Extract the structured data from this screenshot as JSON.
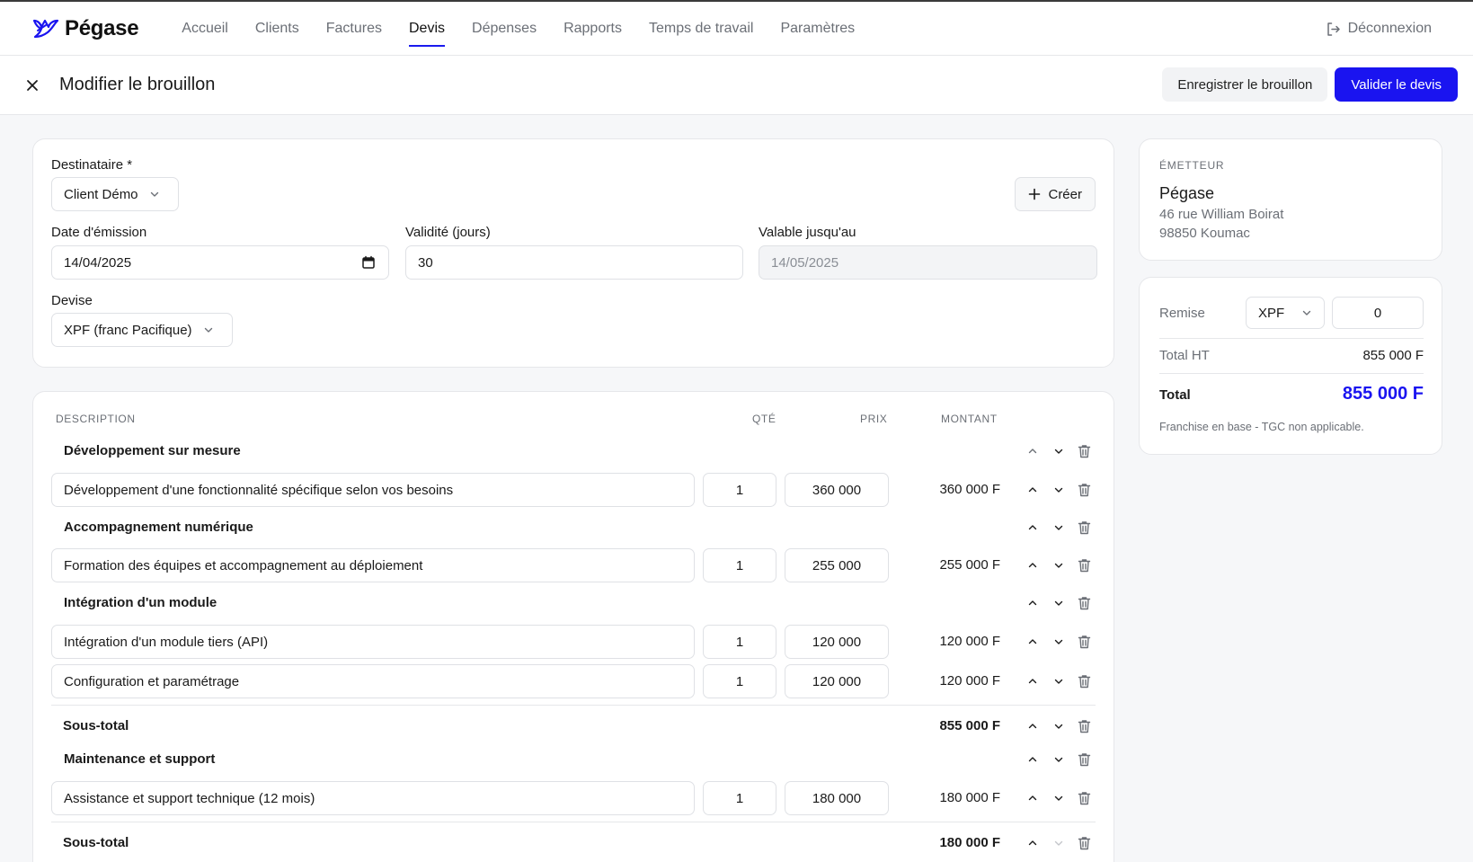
{
  "brand": {
    "name": "Pégase",
    "accent": "#1a14f0"
  },
  "nav": {
    "items": [
      "Accueil",
      "Clients",
      "Factures",
      "Devis",
      "Dépenses",
      "Rapports",
      "Temps de travail",
      "Paramètres"
    ],
    "active": "Devis",
    "logout": "Déconnexion"
  },
  "page": {
    "title": "Modifier le brouillon",
    "save_label": "Enregistrer le brouillon",
    "validate_label": "Valider le devis"
  },
  "form": {
    "recipient_label": "Destinataire *",
    "recipient_value": "Client Démo",
    "create_label": "Créer",
    "issue_date_label": "Date d'émission",
    "issue_date_value": "14/04/2025",
    "validity_label": "Validité (jours)",
    "validity_value": "30",
    "valid_until_label": "Valable jusqu'au",
    "valid_until_value": "14/05/2025",
    "currency_label": "Devise",
    "currency_value": "XPF (franc Pacifique)"
  },
  "table": {
    "headers": {
      "description": "DESCRIPTION",
      "qty": "QTÉ",
      "price": "PRIX",
      "amount": "MONTANT"
    },
    "rows": [
      {
        "type": "section",
        "title": "Développement sur mesure"
      },
      {
        "type": "line",
        "description": "Développement d'une fonctionnalité spécifique selon vos besoins",
        "qty": "1",
        "price": "360 000",
        "amount": "360 000 F"
      },
      {
        "type": "section",
        "title": "Accompagnement numérique"
      },
      {
        "type": "line",
        "description": "Formation des équipes et accompagnement au déploiement",
        "qty": "1",
        "price": "255 000",
        "amount": "255 000 F"
      },
      {
        "type": "section",
        "title": "Intégration d'un module"
      },
      {
        "type": "line",
        "description": "Intégration d'un module tiers (API)",
        "qty": "1",
        "price": "120 000",
        "amount": "120 000 F"
      },
      {
        "type": "line",
        "description": "Configuration et paramétrage",
        "qty": "1",
        "price": "120 000",
        "amount": "120 000 F"
      },
      {
        "type": "subtotal",
        "title": "Sous-total",
        "amount": "855 000 F"
      },
      {
        "type": "section",
        "title": "Maintenance et support"
      },
      {
        "type": "line",
        "description": "Assistance et support technique (12 mois)",
        "qty": "1",
        "price": "180 000",
        "amount": "180 000 F"
      },
      {
        "type": "subtotal",
        "title": "Sous-total",
        "amount": "180 000 F"
      }
    ]
  },
  "emitter": {
    "label": "ÉMETTEUR",
    "name": "Pégase",
    "address_line1": "46 rue William Boirat",
    "address_line2": "98850 Koumac"
  },
  "totals": {
    "discount_label": "Remise",
    "discount_currency": "XPF",
    "discount_value": "0",
    "total_ht_label": "Total HT",
    "total_ht_value": "855 000 F",
    "total_label": "Total",
    "total_value": "855 000 F",
    "note": "Franchise en base - TGC non applicable."
  }
}
